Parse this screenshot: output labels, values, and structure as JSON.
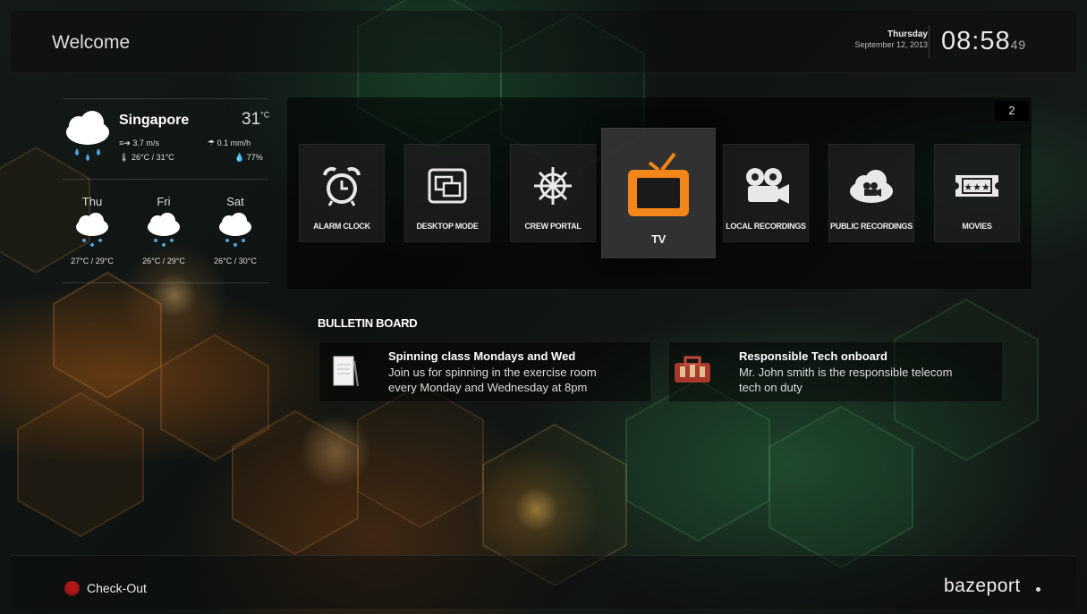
{
  "header": {
    "welcome": "Welcome",
    "day": "Thursday",
    "date": "September 12, 2013",
    "time": "08:58",
    "seconds": "49"
  },
  "weather": {
    "city": "Singapore",
    "temperature": "31",
    "temperature_unit": "°C",
    "wind": "3.7 m/s",
    "rain": "0.1 mm/h",
    "temp_range": "26°C / 31°C",
    "humidity": "77%",
    "icon": "rain-cloud-icon",
    "forecast": [
      {
        "day": "Thu",
        "temps": "27°C / 29°C",
        "icon": "rain-cloud-icon"
      },
      {
        "day": "Fri",
        "temps": "26°C / 29°C",
        "icon": "rain-cloud-icon"
      },
      {
        "day": "Sat",
        "temps": "26°C / 30°C",
        "icon": "rain-cloud-icon"
      }
    ]
  },
  "menu": {
    "page_number": "2",
    "items": [
      {
        "label": "ALARM CLOCK",
        "icon": "alarm-clock-icon"
      },
      {
        "label": "DESKTOP MODE",
        "icon": "desktop-windows-icon"
      },
      {
        "label": "CREW PORTAL",
        "icon": "ship-wheel-icon"
      },
      {
        "label": "TV",
        "icon": "tv-icon",
        "selected": true
      },
      {
        "label": "LOCAL RECORDINGS",
        "icon": "film-camera-icon"
      },
      {
        "label": "PUBLIC RECORDINGS",
        "icon": "cloud-camera-icon"
      },
      {
        "label": "MOVIES",
        "icon": "movie-ticket-icon"
      }
    ]
  },
  "bulletin": {
    "title": "BULLETIN BOARD",
    "notes": [
      {
        "title": "Spinning class Mondays and Wed",
        "line1": "Join us for spinning in the exercise room",
        "line2": "every Monday and Wednesday at 8pm",
        "icon": "notepad-icon"
      },
      {
        "title": "Responsible Tech onboard",
        "line1": "Mr. John smith is the responsible telecom",
        "line2": "tech on duty",
        "icon": "toolbox-icon"
      }
    ]
  },
  "footer": {
    "checkout": "Check-Out",
    "logo": "bazeport"
  },
  "colors": {
    "accent_orange": "#f2861a",
    "checkout_red": "#b01818"
  }
}
